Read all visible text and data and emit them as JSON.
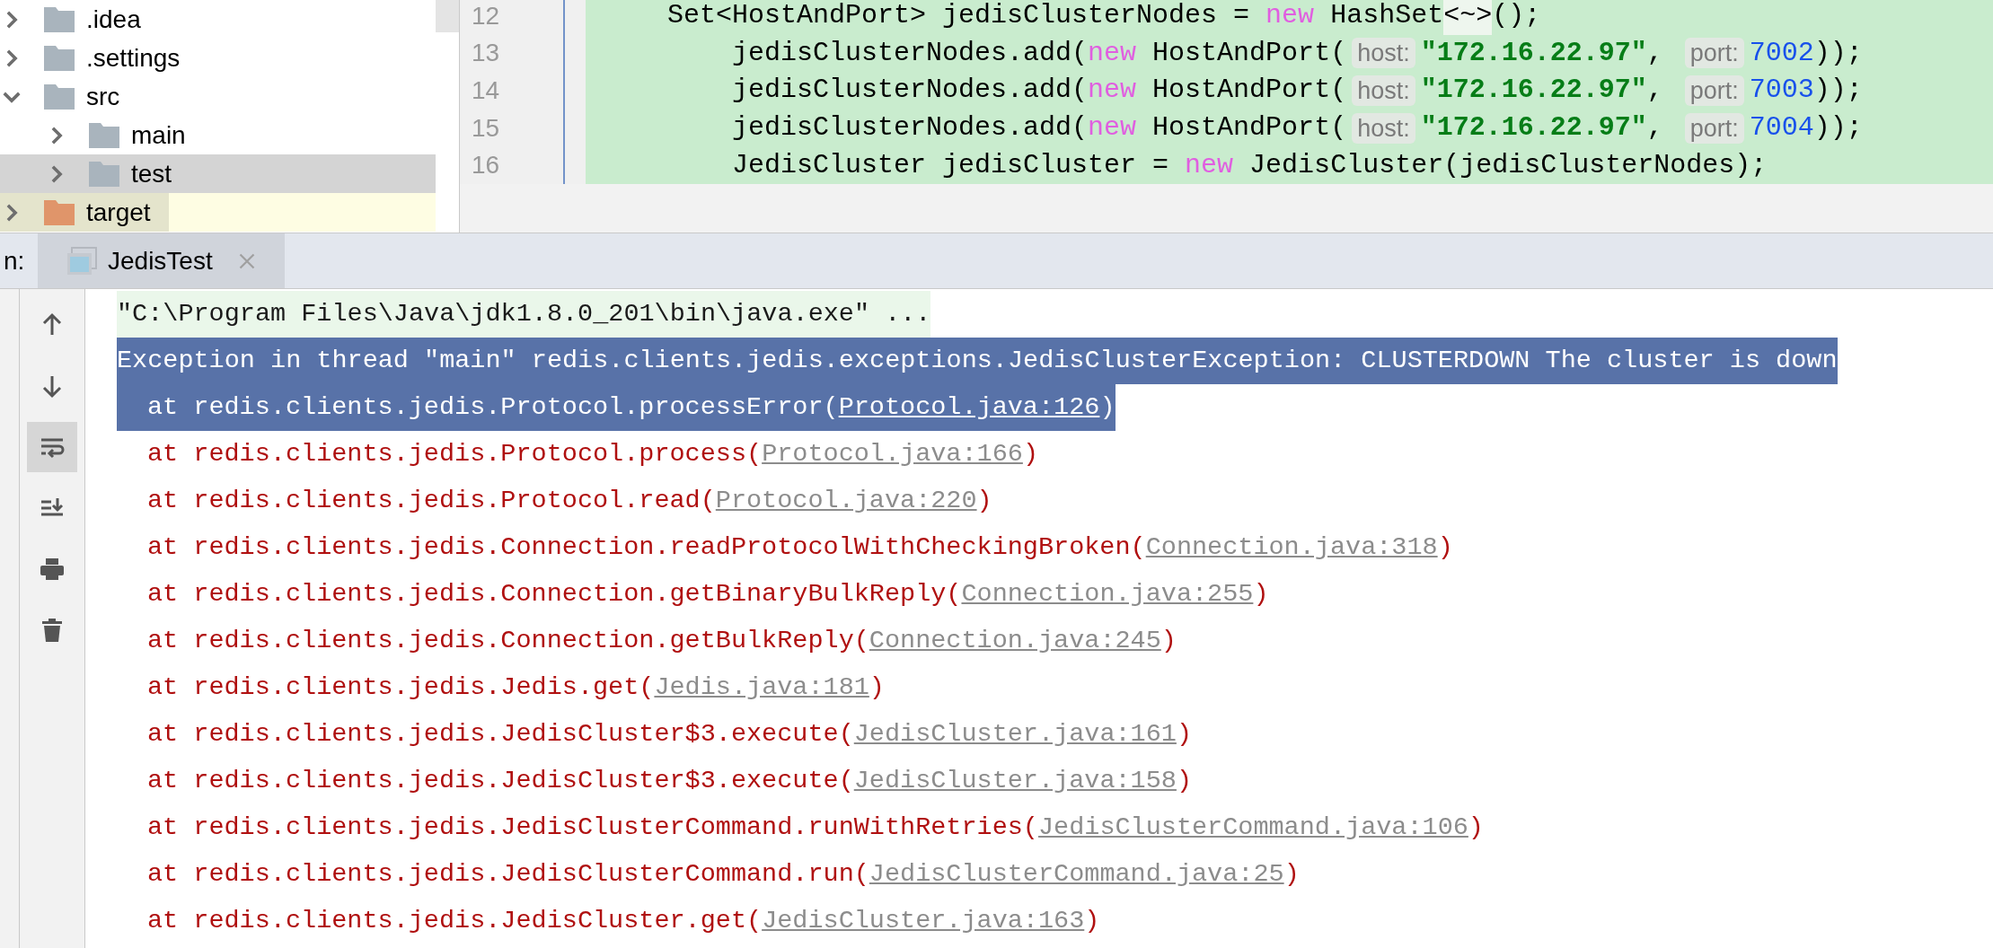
{
  "project_tree": [
    {
      "name": ".idea",
      "expanded": false,
      "selected": false,
      "excluded": false,
      "color": "#a9b4bd"
    },
    {
      "name": ".settings",
      "expanded": false,
      "selected": false,
      "excluded": false,
      "color": "#a9b4bd"
    },
    {
      "name": "src",
      "expanded": true,
      "selected": false,
      "excluded": false,
      "color": "#a9b4bd",
      "children": [
        {
          "name": "main",
          "expanded": false,
          "selected": false,
          "excluded": false,
          "color": "#a9b4bd"
        },
        {
          "name": "test",
          "expanded": false,
          "selected": true,
          "excluded": false,
          "color": "#a9b4bd"
        }
      ]
    },
    {
      "name": "target",
      "expanded": false,
      "selected": false,
      "excluded": true,
      "color": "#e0956a"
    }
  ],
  "editor": {
    "lines": [
      {
        "number": "12",
        "tokens": [
          {
            "kind": "plain",
            "text": "Set<HostAndPort> jedisClusterNodes = "
          },
          {
            "kind": "keyword",
            "text": "new"
          },
          {
            "kind": "plain",
            "text": " HashSet"
          },
          {
            "kind": "fold",
            "text": "<~>"
          },
          {
            "kind": "plain",
            "text": "();"
          }
        ]
      },
      {
        "number": "13",
        "tokens": [
          {
            "kind": "plain",
            "text": "    jedisClusterNodes.add("
          },
          {
            "kind": "keyword",
            "text": "new"
          },
          {
            "kind": "plain",
            "text": " HostAndPort("
          },
          {
            "kind": "hint",
            "text": "host:"
          },
          {
            "kind": "string",
            "text": "\"172.16.22.97\""
          },
          {
            "kind": "plain",
            "text": ", "
          },
          {
            "kind": "hint",
            "text": "port:"
          },
          {
            "kind": "number",
            "text": "7002"
          },
          {
            "kind": "plain",
            "text": "));"
          }
        ]
      },
      {
        "number": "14",
        "tokens": [
          {
            "kind": "plain",
            "text": "    jedisClusterNodes.add("
          },
          {
            "kind": "keyword",
            "text": "new"
          },
          {
            "kind": "plain",
            "text": " HostAndPort("
          },
          {
            "kind": "hint",
            "text": "host:"
          },
          {
            "kind": "string",
            "text": "\"172.16.22.97\""
          },
          {
            "kind": "plain",
            "text": ", "
          },
          {
            "kind": "hint",
            "text": "port:"
          },
          {
            "kind": "number",
            "text": "7003"
          },
          {
            "kind": "plain",
            "text": "));"
          }
        ]
      },
      {
        "number": "15",
        "tokens": [
          {
            "kind": "plain",
            "text": "    jedisClusterNodes.add("
          },
          {
            "kind": "keyword",
            "text": "new"
          },
          {
            "kind": "plain",
            "text": " HostAndPort("
          },
          {
            "kind": "hint",
            "text": "host:"
          },
          {
            "kind": "string",
            "text": "\"172.16.22.97\""
          },
          {
            "kind": "plain",
            "text": ", "
          },
          {
            "kind": "hint",
            "text": "port:"
          },
          {
            "kind": "number",
            "text": "7004"
          },
          {
            "kind": "plain",
            "text": "));"
          }
        ]
      },
      {
        "number": "16",
        "tokens": [
          {
            "kind": "plain",
            "text": "    JedisCluster jedisCluster = "
          },
          {
            "kind": "keyword",
            "text": "new"
          },
          {
            "kind": "plain",
            "text": " JedisCluster(jedisClusterNodes);"
          }
        ]
      }
    ]
  },
  "run_panel": {
    "label": "n:",
    "tabs": [
      {
        "label": "JedisTest",
        "selected": true
      }
    ],
    "soft_wrap": true,
    "lines": [
      {
        "kind": "command",
        "selected": false,
        "text": "\"C:\\Program Files\\Java\\jdk1.8.0_201\\bin\\java.exe\" ..."
      },
      {
        "kind": "exception",
        "selected": true,
        "text": "Exception in thread \"main\" redis.clients.jedis.exceptions.JedisClusterException: CLUSTERDOWN The cluster is down"
      },
      {
        "kind": "frame",
        "selected": true,
        "text": "at redis.clients.jedis.Protocol.processError(",
        "link": "Protocol.java:126",
        "after": ")"
      },
      {
        "kind": "frame",
        "selected": false,
        "text": "at redis.clients.jedis.Protocol.process(",
        "link": "Protocol.java:166",
        "after": ")"
      },
      {
        "kind": "frame",
        "selected": false,
        "text": "at redis.clients.jedis.Protocol.read(",
        "link": "Protocol.java:220",
        "after": ")"
      },
      {
        "kind": "frame",
        "selected": false,
        "text": "at redis.clients.jedis.Connection.readProtocolWithCheckingBroken(",
        "link": "Connection.java:318",
        "after": ")"
      },
      {
        "kind": "frame",
        "selected": false,
        "text": "at redis.clients.jedis.Connection.getBinaryBulkReply(",
        "link": "Connection.java:255",
        "after": ")"
      },
      {
        "kind": "frame",
        "selected": false,
        "text": "at redis.clients.jedis.Connection.getBulkReply(",
        "link": "Connection.java:245",
        "after": ")"
      },
      {
        "kind": "frame",
        "selected": false,
        "text": "at redis.clients.jedis.Jedis.get(",
        "link": "Jedis.java:181",
        "after": ")"
      },
      {
        "kind": "frame",
        "selected": false,
        "text": "at redis.clients.jedis.JedisCluster$3.execute(",
        "link": "JedisCluster.java:161",
        "after": ")"
      },
      {
        "kind": "frame",
        "selected": false,
        "text": "at redis.clients.jedis.JedisCluster$3.execute(",
        "link": "JedisCluster.java:158",
        "after": ")"
      },
      {
        "kind": "frame",
        "selected": false,
        "text": "at redis.clients.jedis.JedisClusterCommand.runWithRetries(",
        "link": "JedisClusterCommand.java:106",
        "after": ")"
      },
      {
        "kind": "frame",
        "selected": false,
        "text": "at redis.clients.jedis.JedisClusterCommand.run(",
        "link": "JedisClusterCommand.java:25",
        "after": ")"
      },
      {
        "kind": "frame",
        "selected": false,
        "text": "at redis.clients.jedis.JedisCluster.get(",
        "link": "JedisCluster.java:163",
        "after": ")"
      }
    ]
  }
}
